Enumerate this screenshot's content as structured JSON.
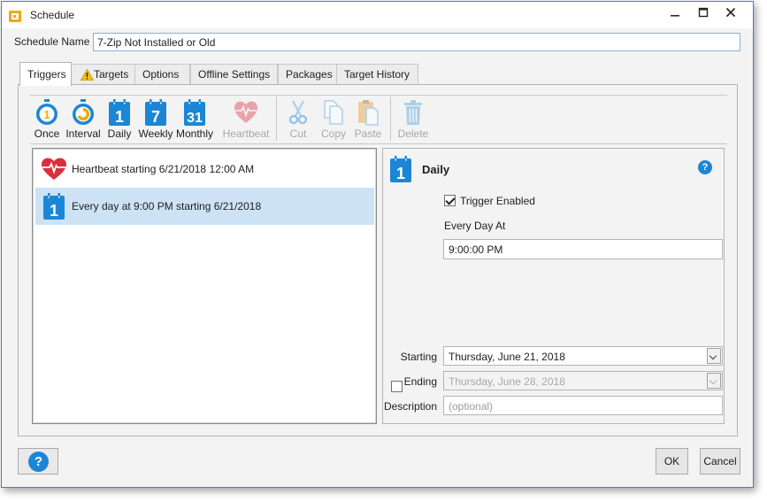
{
  "window": {
    "title": "Schedule"
  },
  "schedule_name": {
    "label": "Schedule Name",
    "value": "7-Zip Not Installed or Old"
  },
  "tabs": [
    {
      "label": "Triggers",
      "active": true
    },
    {
      "label": "Targets",
      "warning": true
    },
    {
      "label": "Options"
    },
    {
      "label": "Offline Settings"
    },
    {
      "label": "Packages"
    },
    {
      "label": "Target History"
    }
  ],
  "toolbar": {
    "once": "Once",
    "interval": "Interval",
    "daily": "Daily",
    "daily_num": "1",
    "weekly": "Weekly",
    "weekly_num": "7",
    "monthly": "Monthly",
    "monthly_num": "31",
    "heartbeat": "Heartbeat",
    "cut": "Cut",
    "copy": "Copy",
    "paste": "Paste",
    "delete": "Delete"
  },
  "triggers": [
    {
      "text": "Heartbeat starting 6/21/2018 12:00 AM",
      "icon": "heart-icon",
      "selected": false
    },
    {
      "text": "Every day at 9:00 PM starting 6/21/2018",
      "icon": "calendar-daily-icon",
      "selected": true
    }
  ],
  "details": {
    "title": "Daily",
    "icon_num": "1",
    "help": "?",
    "trigger_enabled_label": "Trigger Enabled",
    "trigger_enabled": true,
    "every_day_at_label": "Every Day At",
    "time_value": "9:00:00 PM",
    "starting_label": "Starting",
    "starting_value": "Thursday, June 21, 2018",
    "ending_label": "Ending",
    "ending_enabled": false,
    "ending_value": "Thursday, June 28, 2018",
    "description_label": "Description",
    "description_placeholder": "(optional)"
  },
  "footer": {
    "help": "?",
    "ok": "OK",
    "cancel": "Cancel"
  },
  "colors": {
    "accent_blue": "#1c86d6",
    "selection": "#cde3f5",
    "heart_red": "#d9313b",
    "border_blue": "#3c82c8"
  }
}
